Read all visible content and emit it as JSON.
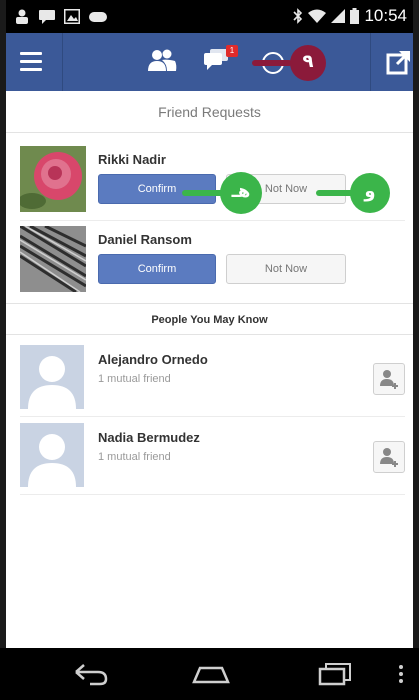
{
  "status_bar": {
    "time": "10:54",
    "left_icons": [
      "user-icon",
      "chat-icon",
      "image-icon",
      "gamepad-icon"
    ],
    "right_icons": [
      "bluetooth-icon",
      "wifi-icon",
      "signal-icon",
      "battery-icon"
    ]
  },
  "app_bar": {
    "color": "#3b5998",
    "tabs": [
      {
        "name": "friends",
        "icon": "friends-icon",
        "active": true
      },
      {
        "name": "messages",
        "icon": "messages-icon",
        "badge": "1"
      },
      {
        "name": "notifications",
        "icon": "globe-icon"
      }
    ],
    "menu_icon": "menu-icon",
    "compose_icon": "share-icon"
  },
  "annotations": [
    {
      "label": "٩",
      "color": "#8b1a3a",
      "target": "notifications"
    },
    {
      "label": "هـ",
      "color": "#3bb54a",
      "target": "confirm"
    },
    {
      "label": "و",
      "color": "#3bb54a",
      "target": "not-now"
    }
  ],
  "friend_requests": {
    "title": "Friend Requests",
    "items": [
      {
        "name": "Rikki Nadir",
        "confirm_label": "Confirm",
        "not_now_label": "Not Now"
      },
      {
        "name": "Daniel Ransom",
        "confirm_label": "Confirm",
        "not_now_label": "Not Now"
      }
    ]
  },
  "people_you_may_know": {
    "title": "People You May Know",
    "items": [
      {
        "name": "Alejandro Ornedo",
        "mutual": "1 mutual friend"
      },
      {
        "name": "Nadia Bermudez",
        "mutual": "1 mutual friend"
      }
    ]
  },
  "nav_bar": {
    "buttons": [
      "back-icon",
      "home-icon",
      "recent-apps-icon",
      "overflow-menu-icon"
    ]
  }
}
